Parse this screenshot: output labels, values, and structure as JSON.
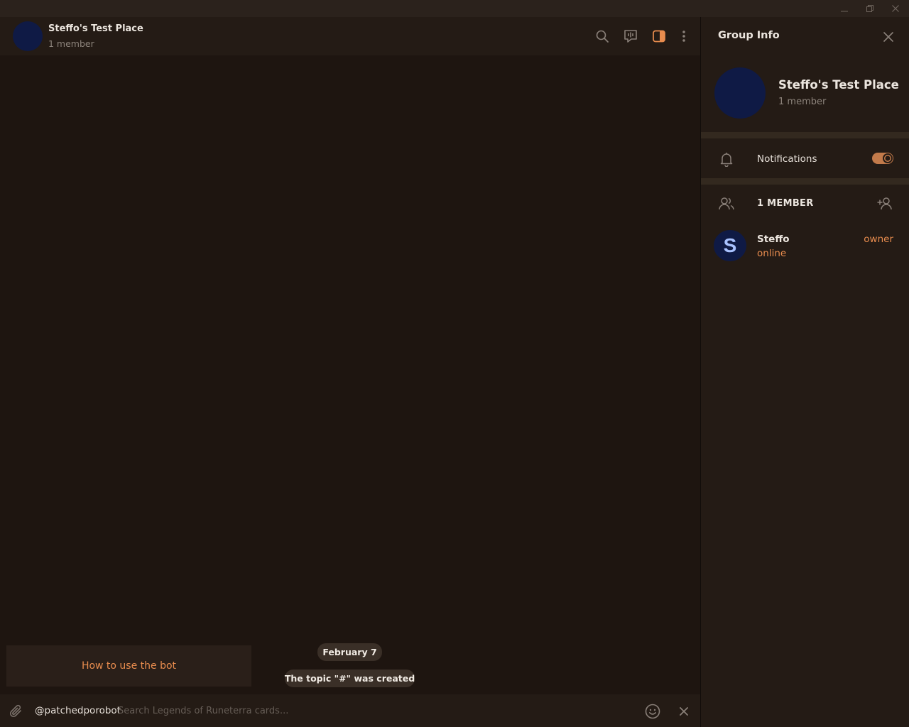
{
  "window": {
    "controls": [
      "minimize-icon",
      "restore-icon",
      "close-icon"
    ]
  },
  "chat": {
    "title": "Steffo's Test Place",
    "subtitle": "1 member",
    "header_icons": [
      "search-icon",
      "live-stream-icon",
      "sidebar-toggle-icon",
      "more-icon"
    ],
    "date_pill": "February 7",
    "service_message": "The topic \"#\" was created",
    "bot_help_button": "How to use the bot",
    "composer": {
      "bot_username": "@patchedporobot",
      "placeholder": "Search Legends of Runeterra cards..."
    }
  },
  "group_info": {
    "title": "Group Info",
    "name": "Steffo's Test Place",
    "subtitle": "1 member",
    "notifications_label": "Notifications",
    "notifications_enabled": true,
    "members_label": "1 MEMBER",
    "members": [
      {
        "initial": "S",
        "name": "Steffo",
        "status": "online",
        "role": "owner"
      }
    ]
  },
  "colors": {
    "background": "#1e1510",
    "panel": "#241b15",
    "accent": "#e88c4e",
    "avatar": "#0f1a45"
  }
}
